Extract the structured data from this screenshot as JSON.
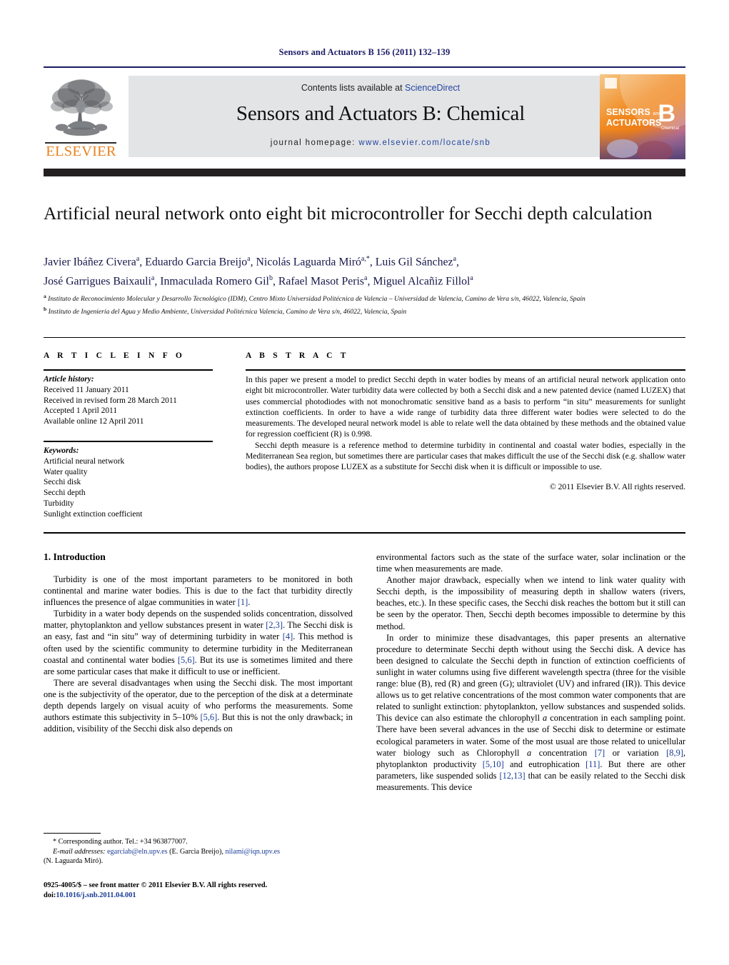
{
  "running_head": "Sensors and Actuators B 156 (2011) 132–139",
  "masthead": {
    "publisher_name": "ELSEVIER",
    "contents_prefix": "Contents lists available at ",
    "contents_link": "ScienceDirect",
    "journal_title": "Sensors and Actuators B: Chemical",
    "homepage_label": "journal homepage: ",
    "homepage_url": "www.elsevier.com/locate/snb",
    "cover": {
      "line1": "SENSORS",
      "line1_small": "and",
      "line2": "ACTUATORS",
      "letter": "B",
      "sub": "Chemical"
    }
  },
  "article": {
    "title": "Artificial neural network onto eight bit microcontroller for Secchi depth calculation",
    "authors_line1": "Javier Ibáñez Civera<sup>a</sup>, Eduardo Garcia Breijo<sup>a</sup>, Nicolás Laguarda Miró<sup>a,*</sup>, Luis Gil Sánchez<sup>a</sup>,",
    "authors_line2": "José Garrigues Baixauli<sup>a</sup>, Inmaculada Romero Gil<sup>b</sup>, Rafael Masot Peris<sup>a</sup>, Miguel Alcañiz Fillol<sup>a</sup>",
    "affiliation_a": "<sup>a</sup> Instituto de Reconocimiento Molecular y Desarrollo Tecnológico (IDM), Centro Mixto Universidad Politécnica de Valencia – Universidad de Valencia, Camino de Vera s/n, 46022, Valencia, Spain",
    "affiliation_b": "<sup>b</sup> Instituto de Ingeniería del Agua y Medio Ambiente, Universidad Politécnica Valencia, Camino de Vera s/n, 46022, Valencia, Spain"
  },
  "info": {
    "heading": "A R T I C L E    I N F O",
    "history_label": "Article history:",
    "history": [
      "Received 11 January 2011",
      "Received in revised form 28 March 2011",
      "Accepted 1 April 2011",
      "Available online 12 April 2011"
    ],
    "keywords_label": "Keywords:",
    "keywords": [
      "Artificial neural network",
      "Water quality",
      "Secchi disk",
      "Secchi depth",
      "Turbidity",
      "Sunlight extinction coefficient"
    ]
  },
  "abstract": {
    "heading": "A B S T R A C T",
    "paragraph1": "In this paper we present a model to predict Secchi depth in water bodies by means of an artificial neural network application onto eight bit microcontroller. Water turbidity data were collected by both a Secchi disk and a new patented device (named LUZEX) that uses commercial photodiodes with not monochromatic sensitive band as a basis to perform “in situ” measurements for sunlight extinction coefficients. In order to have a wide range of turbidity data three different water bodies were selected to do the measurements. The developed neural network model is able to relate well the data obtained by these methods and the obtained value for regression coefficient (R) is 0.998.",
    "paragraph2": "Secchi depth measure is a reference method to determine turbidity in continental and coastal water bodies, especially in the Mediterranean Sea region, but sometimes there are particular cases that makes difficult the use of the Secchi disk (e.g. shallow water bodies), the authors propose LUZEX as a substitute for Secchi disk when it is difficult or impossible to use.",
    "copyright": "© 2011 Elsevier B.V. All rights reserved."
  },
  "body": {
    "section_title": "1.  Introduction",
    "left_paragraphs": [
      "Turbidity is one of the most important parameters to be monitored in both continental and marine water bodies. This is due to the fact that turbidity directly influences the presence of algae communities in water [1].",
      "Turbidity in a water body depends on the suspended solids concentration, dissolved matter, phytoplankton and yellow substances present in water [2,3]. The Secchi disk is an easy, fast and “in situ” way of determining turbidity in water [4]. This method is often used by the scientific community to determine turbidity in the Mediterranean coastal and continental water bodies [5,6]. But its use is sometimes limited and there are some particular cases that make it difficult to use or inefficient.",
      "There are several disadvantages when using the Secchi disk. The most important one is the subjectivity of the operator, due to the perception of the disk at a determinate depth depends largely on visual acuity of who performs the measurements. Some authors estimate this subjectivity in 5–10% [5,6]. But this is not the only drawback; in addition, visibility of the Secchi disk also depends on"
    ],
    "right_paragraphs": [
      "environmental factors such as the state of the surface water, solar inclination or the time when measurements are made.",
      "Another major drawback, especially when we intend to link water quality with Secchi depth, is the impossibility of measuring depth in shallow waters (rivers, beaches, etc.). In these specific cases, the Secchi disk reaches the bottom but it still can be seen by the operator. Then, Secchi depth becomes impossible to determine by this method.",
      "In order to minimize these disadvantages, this paper presents an alternative procedure to determinate Secchi depth without using the Secchi disk. A device has been designed to calculate the Secchi depth in function of extinction coefficients of sunlight in water columns using five different wavelength spectra (three for the visible range: blue (B), red (R) and green (G); ultraviolet (UV) and infrared (IR)). This device allows us to get relative concentrations of the most common water components that are related to sunlight extinction: phytoplankton, yellow substances and suspended solids. This device can also estimate the chlorophyll a concentration in each sampling point. There have been several advances in the use of Secchi disk to determine or estimate ecological parameters in water. Some of the most usual are those related to unicellular water biology such as Chlorophyll a concentration [7] or variation [8,9], phytoplankton productivity [5,10] and eutrophication [11]. But there are other parameters, like suspended solids [12,13] that can be easily related to the Secchi disk measurements. This device"
    ]
  },
  "footnotes": {
    "corresponding": "*  Corresponding author. Tel.: +34 963877007.",
    "email_label": "E-mail addresses:",
    "email1": "egarciab@eln.upv.es",
    "email1_name": " (E. Garcia Breijo), ",
    "email2": "nilami@iqn.upv.es",
    "email2_name": "(N. Laguarda Miró).",
    "imprint": "0925-4005/$ – see front matter © 2011 Elsevier B.V. All rights reserved.",
    "doi_label": "doi:",
    "doi": "10.1016/j.snb.2011.04.001"
  },
  "colors": {
    "rule_navy": "#1a1a64",
    "link_blue": "#2346a0",
    "ref_blue": "#1a3c96",
    "elsevier_orange": "#e8821e",
    "masthead_gray": "#e3e4e6",
    "black_bar": "#231f20"
  }
}
